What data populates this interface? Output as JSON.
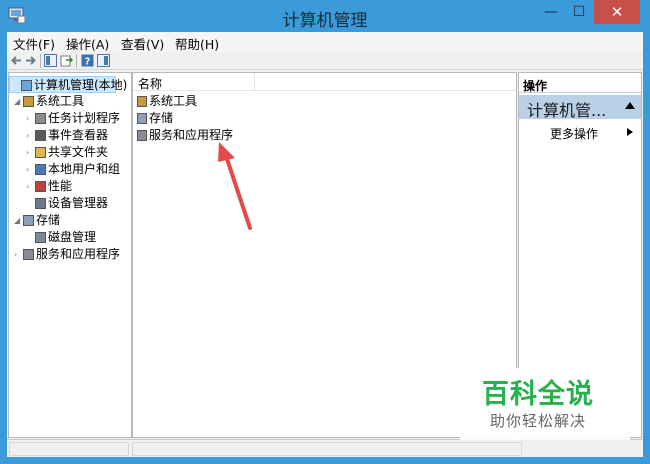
{
  "window": {
    "title": "计算机管理"
  },
  "menu": [
    "文件(F)",
    "操作(A)",
    "查看(V)",
    "帮助(H)"
  ],
  "tree": [
    {
      "label": "计算机管理(本地)",
      "level": 0,
      "expander": "",
      "icon": "computer-management-icon",
      "selected": true
    },
    {
      "label": "系统工具",
      "level": 1,
      "expander": "◢",
      "icon": "system-tools-icon"
    },
    {
      "label": "任务计划程序",
      "level": 2,
      "expander": "›",
      "icon": "task-scheduler-icon"
    },
    {
      "label": "事件查看器",
      "level": 2,
      "expander": "›",
      "icon": "event-viewer-icon"
    },
    {
      "label": "共享文件夹",
      "level": 2,
      "expander": "›",
      "icon": "shared-folders-icon"
    },
    {
      "label": "本地用户和组",
      "level": 2,
      "expander": "›",
      "icon": "local-users-icon"
    },
    {
      "label": "性能",
      "level": 2,
      "expander": "›",
      "icon": "performance-icon"
    },
    {
      "label": "设备管理器",
      "level": 2,
      "expander": "",
      "icon": "device-manager-icon"
    },
    {
      "label": "存储",
      "level": 1,
      "expander": "◢",
      "icon": "storage-icon"
    },
    {
      "label": "磁盘管理",
      "level": 2,
      "expander": "",
      "icon": "disk-management-icon"
    },
    {
      "label": "服务和应用程序",
      "level": 1,
      "expander": "›",
      "icon": "services-apps-icon"
    }
  ],
  "list": {
    "header": "名称",
    "items": [
      {
        "label": "系统工具",
        "icon": "system-tools-icon"
      },
      {
        "label": "存储",
        "icon": "storage-icon"
      },
      {
        "label": "服务和应用程序",
        "icon": "services-apps-icon"
      }
    ]
  },
  "actions": {
    "header": "操作",
    "section": "计算机管...",
    "items": [
      "更多操作"
    ]
  },
  "watermark": {
    "title": "百科全说",
    "subtitle": "助你轻松解决"
  },
  "colors": {
    "titlebar": "#3b9ad9",
    "close": "#c7504b",
    "accent": "#27b14a",
    "arrow": "#e24a4a"
  }
}
